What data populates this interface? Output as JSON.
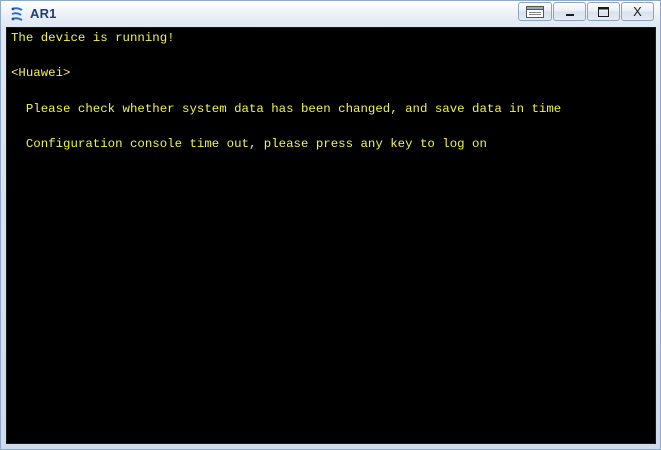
{
  "window": {
    "title": "AR1",
    "controls": {
      "restore_icon": "window-restore-icon",
      "minimize_icon": "minimize-icon",
      "maximize_icon": "maximize-icon",
      "close_label": "X"
    },
    "app_icon": "huawei-ensp-icon"
  },
  "console": {
    "text_color": "#f2f24a",
    "background": "#000000",
    "lines": [
      "The device is running!",
      "",
      "<Huawei>",
      "",
      "  Please check whether system data has been changed, and save data in time",
      "",
      "  Configuration console time out, please press any key to log on"
    ]
  }
}
